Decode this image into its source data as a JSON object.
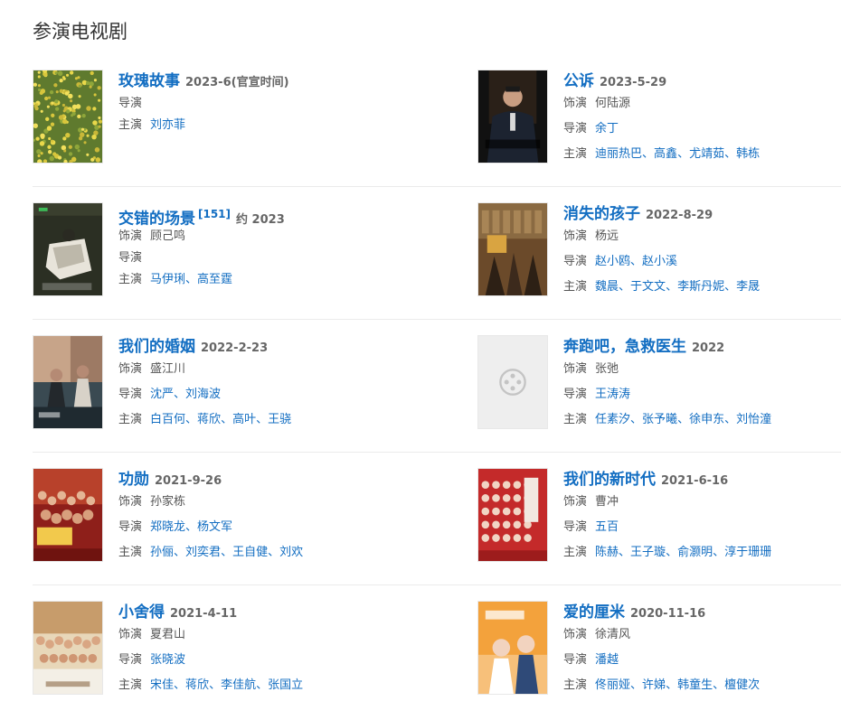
{
  "section_title": "参演电视剧",
  "dramas": [
    {
      "title": "玫瑰故事",
      "citation": "",
      "date": "2023-6(官宣时间)",
      "poster": "flowers",
      "rows": [
        {
          "label": "导演",
          "names": [],
          "kind": "none"
        },
        {
          "label": "主演",
          "names": [
            "刘亦菲"
          ],
          "kind": "link"
        }
      ]
    },
    {
      "title": "公诉",
      "citation": "",
      "date": "2023-5-29",
      "poster": "prosecutor",
      "rows": [
        {
          "label": "饰演",
          "value": "何陆源",
          "kind": "text"
        },
        {
          "label": "导演",
          "names": [
            "余丁"
          ],
          "kind": "link"
        },
        {
          "label": "主演",
          "names": [
            "迪丽热巴",
            "高鑫",
            "尤靖茹",
            "韩栋"
          ],
          "kind": "link"
        }
      ]
    },
    {
      "title": "交错的场景",
      "citation": "[151]",
      "date": "约 2023",
      "poster": "scene",
      "rows": [
        {
          "label": "饰演",
          "value": "顾己鸣",
          "kind": "text"
        },
        {
          "label": "导演",
          "names": [],
          "kind": "none"
        },
        {
          "label": "主演",
          "names": [
            "马伊琍",
            "高至霆"
          ],
          "kind": "link"
        }
      ]
    },
    {
      "title": "消失的孩子",
      "citation": "",
      "date": "2022-8-29",
      "poster": "missing",
      "rows": [
        {
          "label": "饰演",
          "value": "杨远",
          "kind": "text"
        },
        {
          "label": "导演",
          "names": [
            "赵小鸥",
            "赵小溪"
          ],
          "kind": "link"
        },
        {
          "label": "主演",
          "names": [
            "魏晨",
            "于文文",
            "李斯丹妮",
            "李晟"
          ],
          "kind": "link"
        }
      ]
    },
    {
      "title": "我们的婚姻",
      "citation": "",
      "date": "2022-2-23",
      "poster": "marriage",
      "rows": [
        {
          "label": "饰演",
          "value": "盛江川",
          "kind": "text"
        },
        {
          "label": "导演",
          "names": [
            "沈严",
            "刘海波"
          ],
          "kind": "link"
        },
        {
          "label": "主演",
          "names": [
            "白百何",
            "蒋欣",
            "高叶",
            "王骁"
          ],
          "kind": "link"
        }
      ]
    },
    {
      "title": "奔跑吧，急救医生",
      "citation": "",
      "date": "2022",
      "poster": "placeholder",
      "rows": [
        {
          "label": "饰演",
          "value": "张弛",
          "kind": "text"
        },
        {
          "label": "导演",
          "names": [
            "王涛涛"
          ],
          "kind": "link"
        },
        {
          "label": "主演",
          "names": [
            "任素汐",
            "张予曦",
            "徐申东",
            "刘怡潼"
          ],
          "kind": "link"
        }
      ]
    },
    {
      "title": "功勋",
      "citation": "",
      "date": "2021-9-26",
      "poster": "merit",
      "rows": [
        {
          "label": "饰演",
          "value": "孙家栋",
          "kind": "text"
        },
        {
          "label": "导演",
          "names": [
            "郑晓龙",
            "杨文军"
          ],
          "kind": "link"
        },
        {
          "label": "主演",
          "names": [
            "孙俪",
            "刘奕君",
            "王自健",
            "刘欢"
          ],
          "kind": "link"
        }
      ]
    },
    {
      "title": "我们的新时代",
      "citation": "",
      "date": "2021-6-16",
      "poster": "newera",
      "rows": [
        {
          "label": "饰演",
          "value": "曹冲",
          "kind": "text"
        },
        {
          "label": "导演",
          "names": [
            "五百"
          ],
          "kind": "link"
        },
        {
          "label": "主演",
          "names": [
            "陈赫",
            "王子璇",
            "俞灏明",
            "淳于珊珊"
          ],
          "kind": "link"
        }
      ]
    },
    {
      "title": "小舍得",
      "citation": "",
      "date": "2021-4-11",
      "poster": "family",
      "rows": [
        {
          "label": "饰演",
          "value": "夏君山",
          "kind": "text"
        },
        {
          "label": "导演",
          "names": [
            "张晓波"
          ],
          "kind": "link"
        },
        {
          "label": "主演",
          "names": [
            "宋佳",
            "蒋欣",
            "李佳航",
            "张国立"
          ],
          "kind": "link"
        }
      ]
    },
    {
      "title": "爱的厘米",
      "citation": "",
      "date": "2020-11-16",
      "poster": "love",
      "rows": [
        {
          "label": "饰演",
          "value": "徐清风",
          "kind": "text"
        },
        {
          "label": "导演",
          "names": [
            "潘越"
          ],
          "kind": "link"
        },
        {
          "label": "主演",
          "names": [
            "佟丽娅",
            "许娣",
            "韩童生",
            "檀健次"
          ],
          "kind": "link"
        }
      ]
    }
  ]
}
